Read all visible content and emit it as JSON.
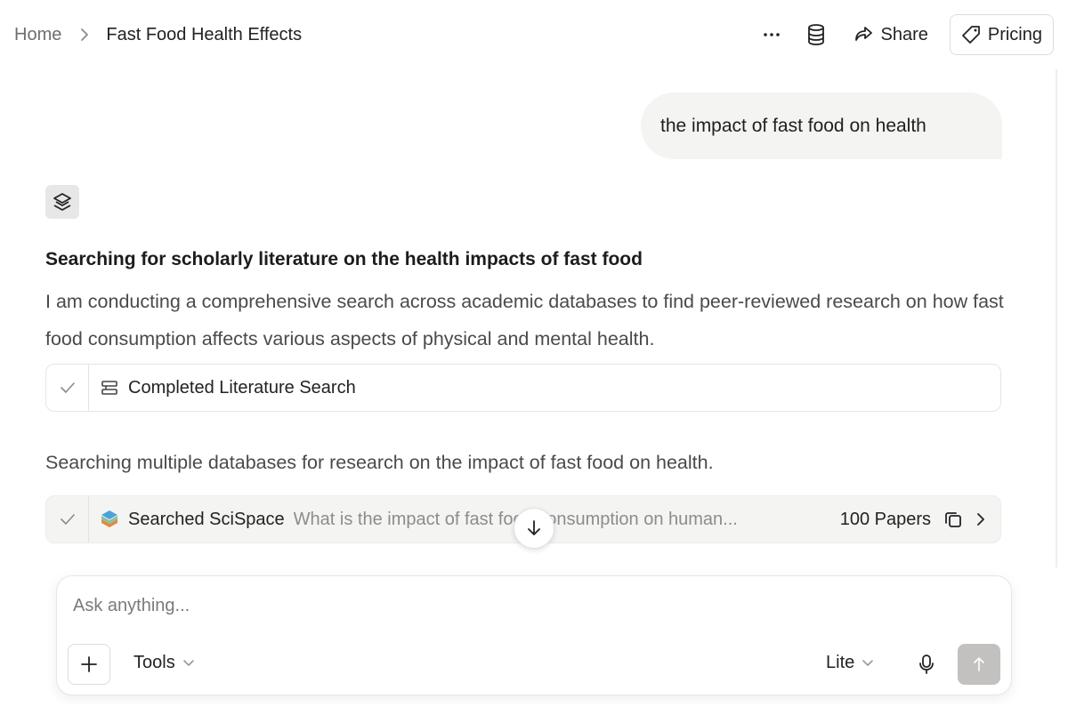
{
  "breadcrumb": {
    "home": "Home",
    "current": "Fast Food Health Effects"
  },
  "header": {
    "more_icon": "more-horizontal-icon",
    "database_icon": "database-icon",
    "share_label": "Share",
    "pricing_label": "Pricing"
  },
  "conversation": {
    "user_message": "the impact of fast food on health",
    "heading": "Searching for scholarly literature on the health impacts of fast food",
    "paragraph": "I am conducting a comprehensive search across academic databases to find peer-reviewed research on how fast food consumption affects various aspects of physical and mental health.",
    "step1_label": "Completed Literature Search",
    "paragraph2": "Searching multiple databases for research on the impact of fast food on health.",
    "step2_label": "Searched SciSpace",
    "step2_query": "What is the impact of fast food consumption on human...",
    "step2_count": "100 Papers"
  },
  "composer": {
    "placeholder": "Ask anything...",
    "tools_label": "Tools",
    "mode_label": "Lite"
  },
  "colors": {
    "send_disabled": "#c2c1bf",
    "bubble_bg": "#f4f4f2",
    "scispace_top": "#4aa3d6",
    "scispace_bottom": "#e8873a"
  }
}
